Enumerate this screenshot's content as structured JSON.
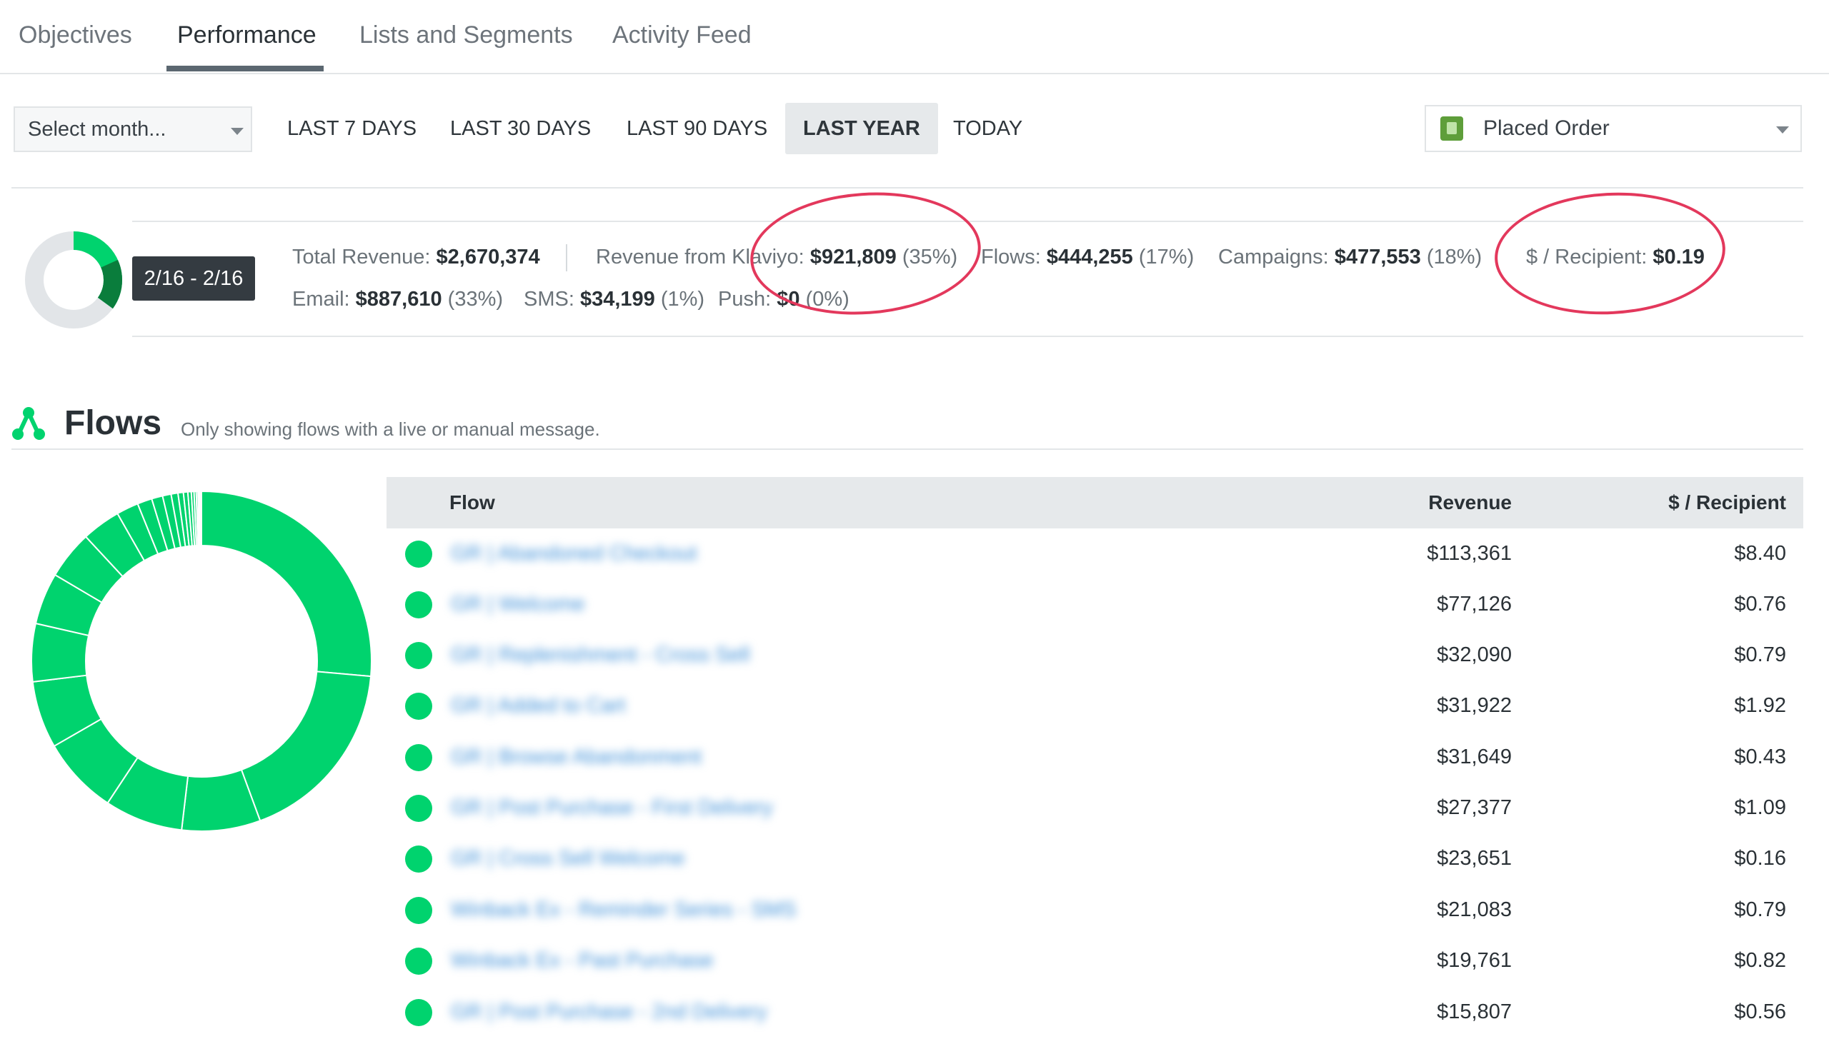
{
  "tabs": [
    "Objectives",
    "Performance",
    "Lists and Segments",
    "Activity Feed"
  ],
  "filters": {
    "select_month": "Select month...",
    "ranges": [
      "LAST 7 DAYS",
      "LAST 30 DAYS",
      "LAST 90 DAYS",
      "LAST YEAR",
      "TODAY"
    ],
    "active_range": "LAST YEAR",
    "metric": "Placed Order"
  },
  "summary": {
    "date_range": "2/16 - 2/16",
    "total_revenue_label": "Total Revenue:",
    "total_revenue": "$2,670,374",
    "klaviyo_label": "Revenue from Klaviyo:",
    "klaviyo_value": "$921,809",
    "klaviyo_pct": "(35%)",
    "flows_label": "Flows:",
    "flows_value": "$444,255",
    "flows_pct": "(17%)",
    "campaigns_label": "Campaigns:",
    "campaigns_value": "$477,553",
    "campaigns_pct": "(18%)",
    "per_recipient_label": "$ / Recipient:",
    "per_recipient_value": "$0.19",
    "email_label": "Email:",
    "email_value": "$887,610",
    "email_pct": "(33%)",
    "sms_label": "SMS:",
    "sms_value": "$34,199",
    "sms_pct": "(1%)",
    "push_label": "Push:",
    "push_value": "$0",
    "push_pct": "(0%)",
    "donut_fraction": 0.35
  },
  "flows": {
    "title": "Flows",
    "subtitle": "Only showing flows with a live or manual message.",
    "columns": {
      "flow": "Flow",
      "revenue": "Revenue",
      "per_recipient": "$ / Recipient"
    },
    "rows": [
      {
        "name": "GR | Abandoned Checkout",
        "revenue": "$113,361",
        "per_recipient": "$8.40"
      },
      {
        "name": "GR | Welcome",
        "revenue": "$77,126",
        "per_recipient": "$0.76"
      },
      {
        "name": "GR | Replenishment - Cross Sell",
        "revenue": "$32,090",
        "per_recipient": "$0.79"
      },
      {
        "name": "GR | Added to Cart",
        "revenue": "$31,922",
        "per_recipient": "$1.92"
      },
      {
        "name": "GR | Browse Abandonment",
        "revenue": "$31,649",
        "per_recipient": "$0.43"
      },
      {
        "name": "GR | Post Purchase - First Delivery",
        "revenue": "$27,377",
        "per_recipient": "$1.09"
      },
      {
        "name": "GR | Cross Sell Welcome",
        "revenue": "$23,651",
        "per_recipient": "$0.16"
      },
      {
        "name": "Winback Ex - Reminder Series - SMS",
        "revenue": "$21,083",
        "per_recipient": "$0.79"
      },
      {
        "name": "Winback Ex - Past Purchase",
        "revenue": "$19,761",
        "per_recipient": "$0.82"
      },
      {
        "name": "GR | Post Purchase - 2nd Delivery",
        "revenue": "$15,807",
        "per_recipient": "$0.56"
      }
    ],
    "donut_segments": [
      113361,
      77126,
      32090,
      31922,
      31649,
      27377,
      23651,
      21083,
      19761,
      15807,
      9000,
      6000,
      4500,
      3500,
      2800,
      2200,
      1800,
      1400,
      1100,
      900,
      700,
      500,
      400,
      300,
      200
    ]
  },
  "colors": {
    "accent_green": "#00d36e",
    "dark_green": "#0a7d3c",
    "annotation_red": "#e3385c"
  }
}
